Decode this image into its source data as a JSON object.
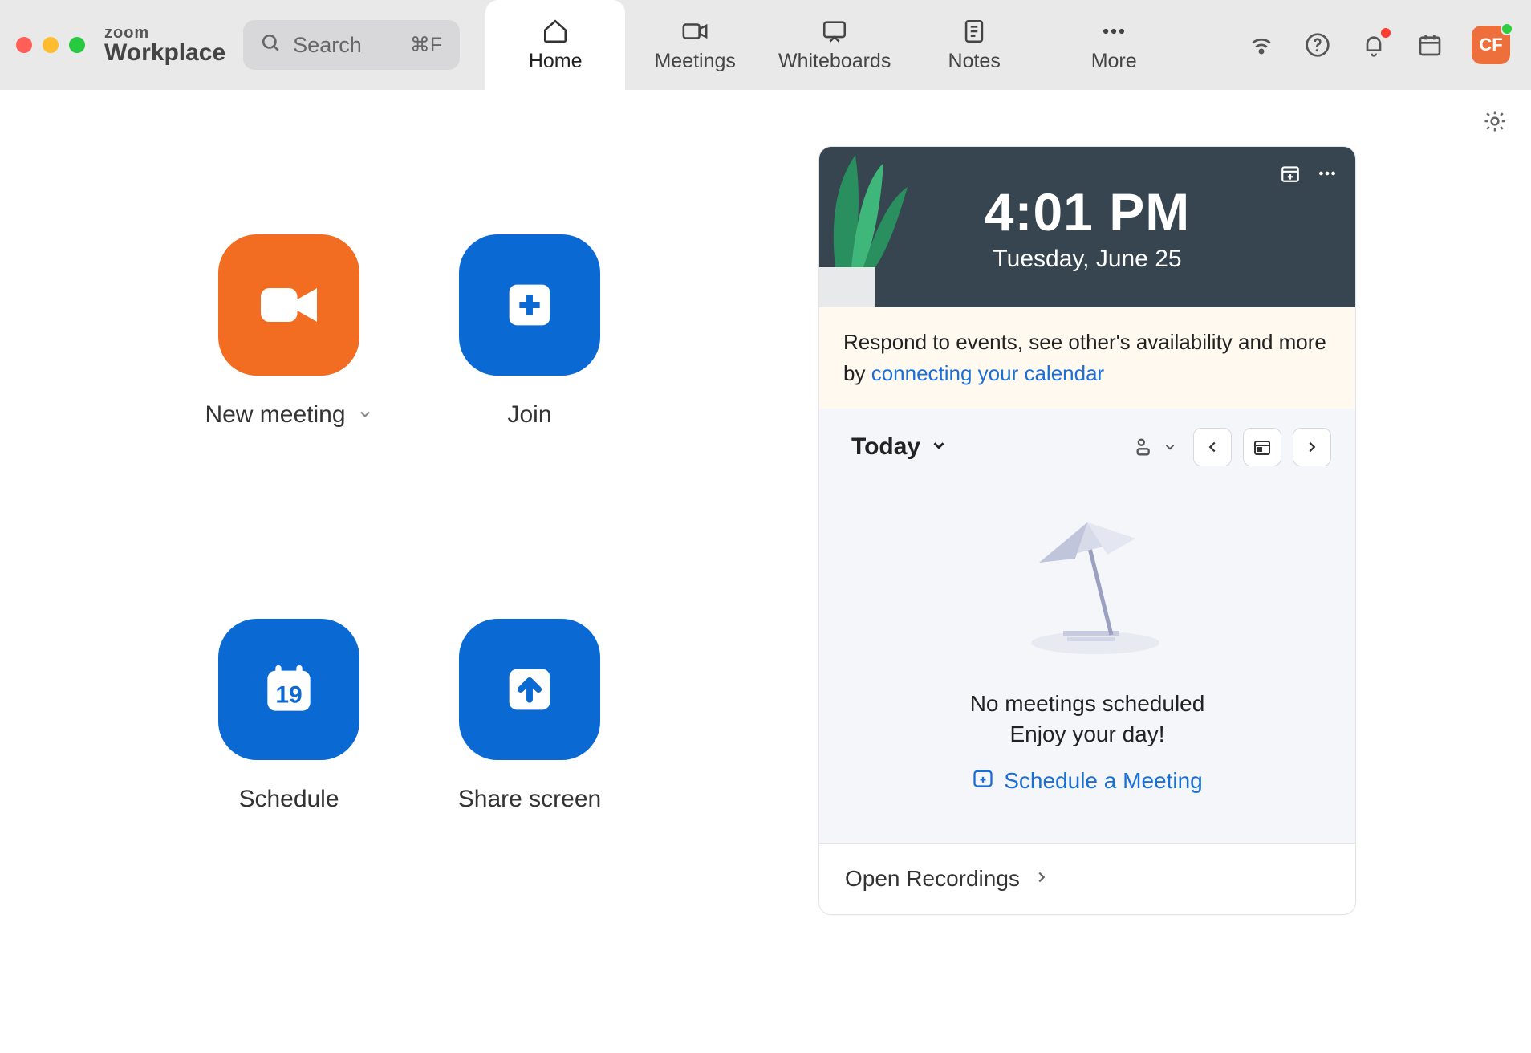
{
  "brand": {
    "line1": "zoom",
    "line2": "Workplace"
  },
  "search": {
    "placeholder": "Search",
    "shortcut": "⌘F"
  },
  "nav": {
    "items": [
      {
        "label": "Home",
        "active": true
      },
      {
        "label": "Meetings"
      },
      {
        "label": "Whiteboards"
      },
      {
        "label": "Notes"
      },
      {
        "label": "More"
      }
    ]
  },
  "avatar": {
    "initials": "CF"
  },
  "actions": {
    "new_meeting": "New meeting",
    "join": "Join",
    "schedule": "Schedule",
    "schedule_day": "19",
    "share_screen": "Share screen"
  },
  "clock": {
    "time": "4:01 PM",
    "date": "Tuesday, June 25"
  },
  "connect_prompt": {
    "prefix": "Respond to events, see other's availability and more by ",
    "link": "connecting your calendar"
  },
  "day_nav": {
    "today_label": "Today"
  },
  "empty": {
    "line1": "No meetings scheduled",
    "line2": "Enjoy your day!",
    "schedule_link": "Schedule a Meeting"
  },
  "recordings": {
    "label": "Open Recordings"
  }
}
